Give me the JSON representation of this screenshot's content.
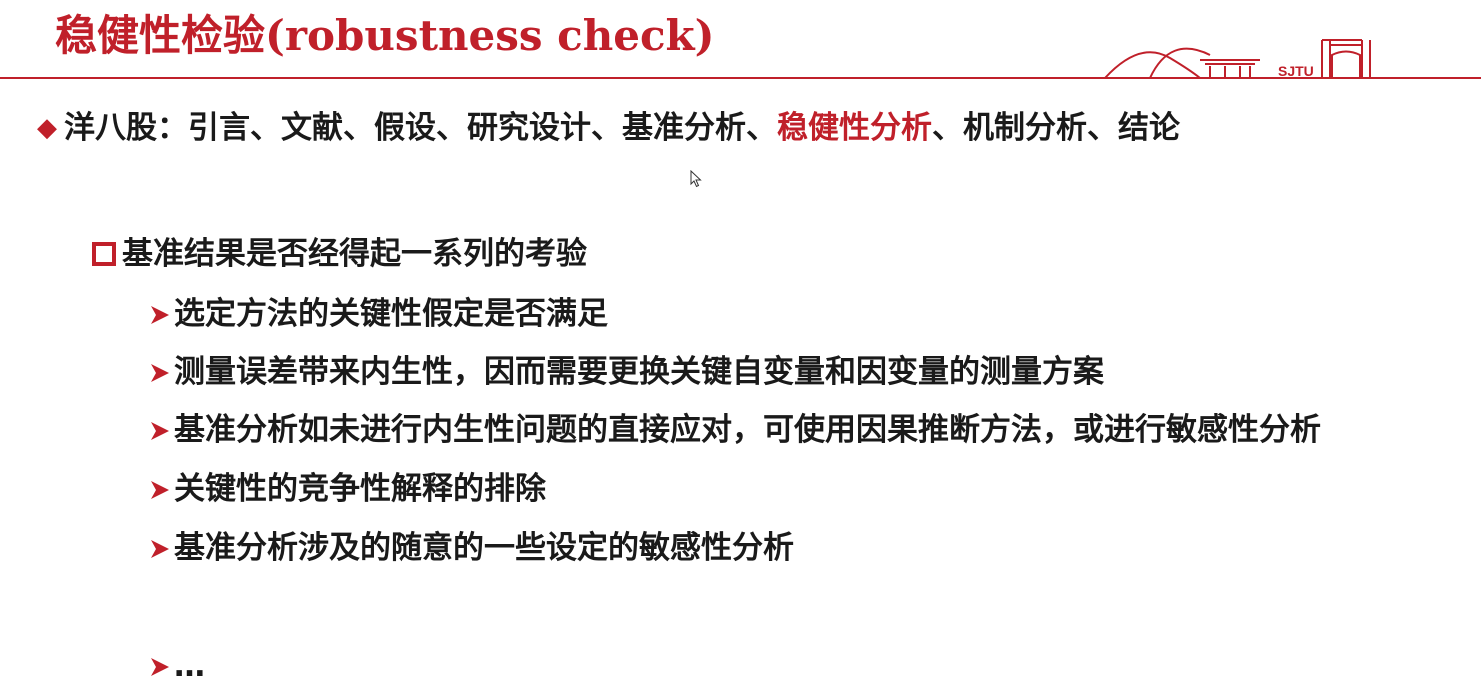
{
  "slide": {
    "title": "稳健性检验(robustness check)",
    "logo_text": "SJTU"
  },
  "level1": {
    "prefix": "洋八股：引言、文献、假设、研究设计、基准分析、",
    "highlight": "稳健性分析",
    "suffix": "、机制分析、结论"
  },
  "level2": {
    "text": "基准结果是否经得起一系列的考验"
  },
  "level3_items": [
    "选定方法的关键性假定是否满足",
    "测量误差带来内生性，因而需要更换关键自变量和因变量的测量方案",
    "基准分析如未进行内生性问题的直接应对，可使用因果推断方法，或进行敏感性分析",
    "关键性的竞争性解释的排除",
    "基准分析涉及的随意的一些设定的敏感性分析",
    "…"
  ],
  "colors": {
    "accent": "#c0202a",
    "text": "#1a1a1a"
  },
  "icons": {
    "level1_marker": "diamond-bullet-icon",
    "level2_marker": "square-bullet-icon",
    "level3_marker": "arrow-bullet-icon",
    "cursor": "mouse-pointer-icon"
  }
}
